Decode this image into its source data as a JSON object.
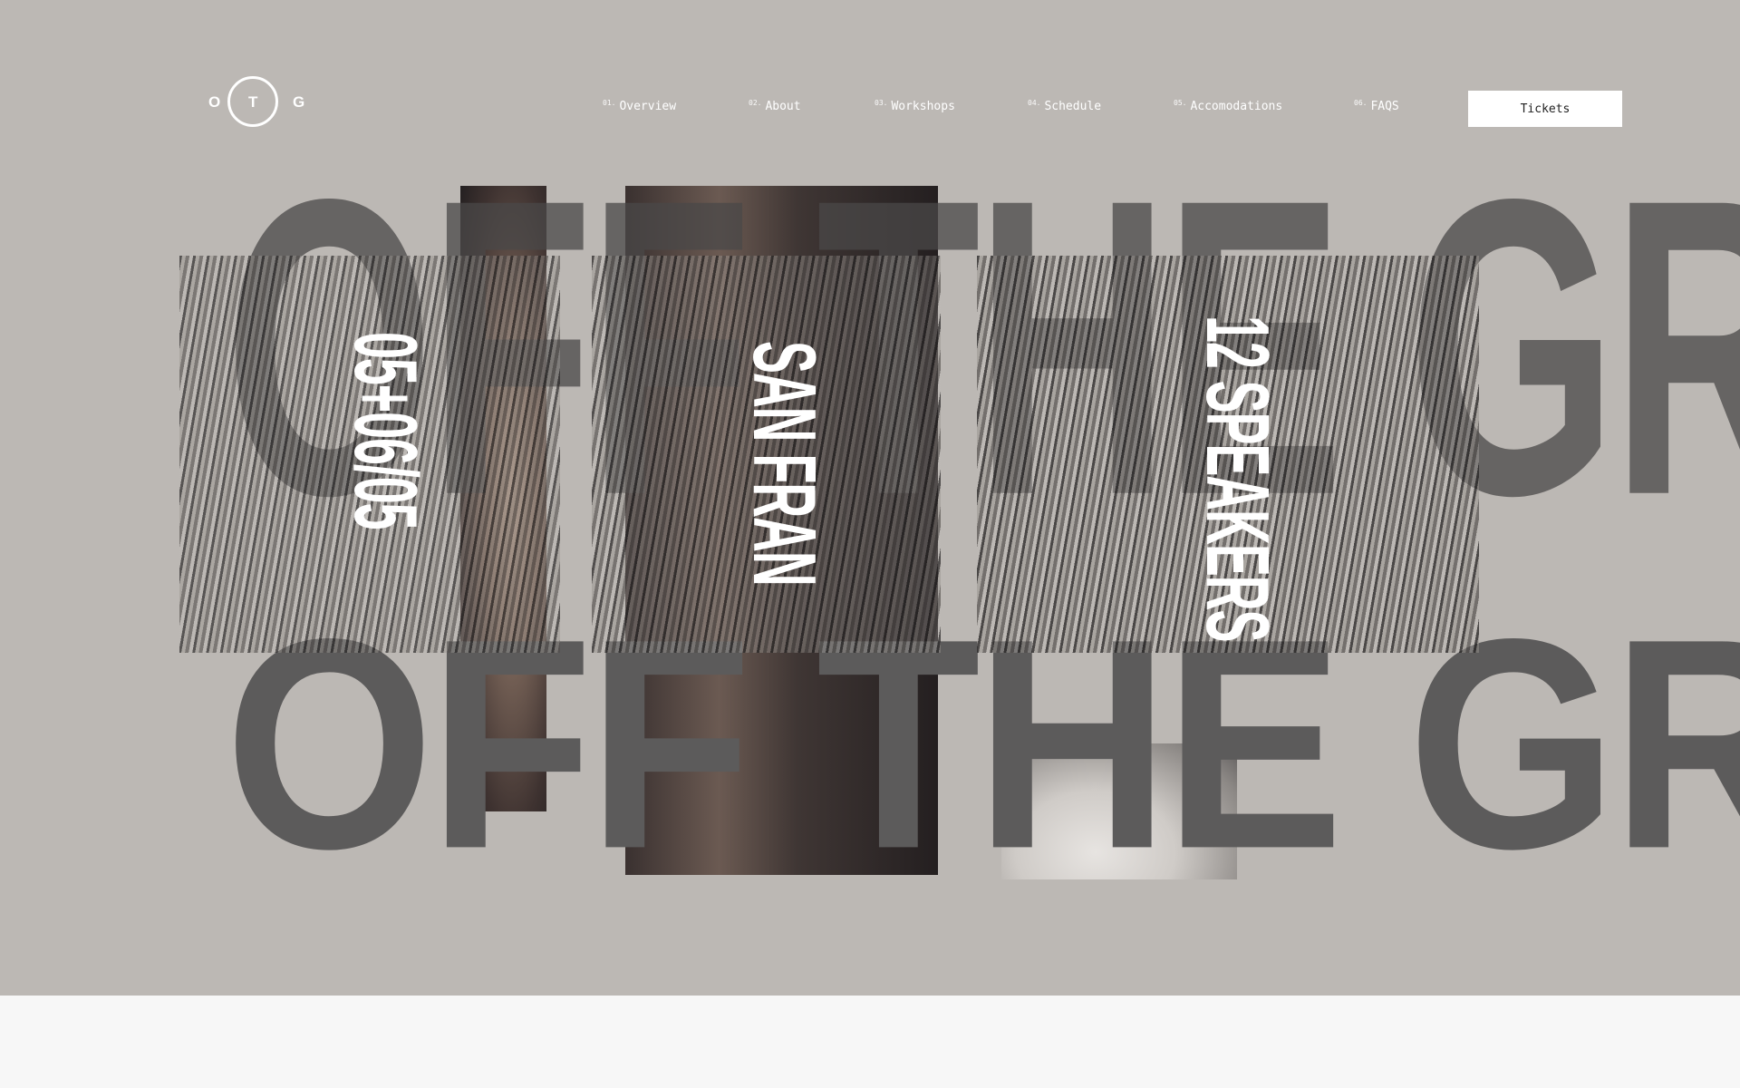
{
  "logo": {
    "letters": [
      "O",
      "T",
      "G"
    ]
  },
  "nav": {
    "items": [
      {
        "num": "01.",
        "label": "Overview"
      },
      {
        "num": "02.",
        "label": "About"
      },
      {
        "num": "03.",
        "label": "Workshops"
      },
      {
        "num": "04.",
        "label": "Schedule"
      },
      {
        "num": "05.",
        "label": "Accomodations"
      },
      {
        "num": "06.",
        "label": "FAQS"
      }
    ],
    "tickets_label": "Tickets"
  },
  "hero": {
    "headline_top": "OFF THE GRID.",
    "headline_bottom": "OFF THE GRID.",
    "date": "05+06/05",
    "city": "SAN FRAN",
    "speakers": "12 SPEAKERS"
  },
  "colors": {
    "hero_bg": "#bcb8b4",
    "page_bg": "#f7f7f7",
    "headline": "#5c5b5b",
    "accent": "#ffffff"
  }
}
